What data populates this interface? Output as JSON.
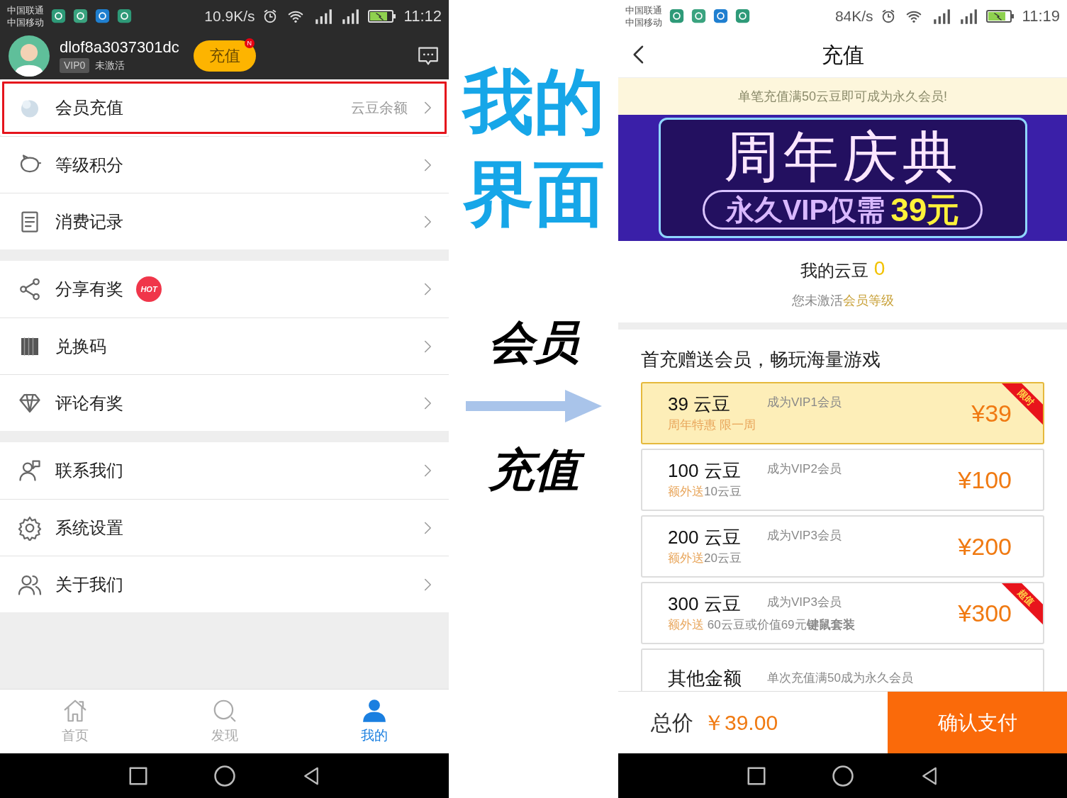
{
  "left_phone": {
    "status_bar": {
      "carriers": [
        "中国联通",
        "中国移动"
      ],
      "speed": "10.9K/s",
      "time": "11:12"
    },
    "profile": {
      "username": "dlof8a3037301dc",
      "vip": "VIP0",
      "state": "未激活",
      "recharge_button": "充值",
      "badge": "N"
    },
    "menu_groups": [
      {
        "items": [
          {
            "label": "会员充值",
            "hint": "云豆余额",
            "highlighted": true
          },
          {
            "label": "等级积分",
            "highlighted": false
          },
          {
            "label": "消费记录",
            "highlighted": false
          }
        ]
      },
      {
        "items": [
          {
            "label": "分享有奖",
            "badge": "HOT",
            "highlighted": false
          },
          {
            "label": "兑换码",
            "highlighted": false
          },
          {
            "label": "评论有奖",
            "highlighted": false
          }
        ]
      },
      {
        "items": [
          {
            "label": "联系我们",
            "highlighted": false
          },
          {
            "label": "系统设置",
            "highlighted": false
          },
          {
            "label": "关于我们",
            "highlighted": false
          }
        ]
      }
    ],
    "tabs": [
      {
        "label": "首页",
        "selected": false
      },
      {
        "label": "发现",
        "selected": false
      },
      {
        "label": "我的",
        "selected": true
      }
    ]
  },
  "annotation": {
    "title_lines": [
      "我的",
      "界面"
    ],
    "from": "会员",
    "to": "充值"
  },
  "right_phone": {
    "status_bar": {
      "carriers": [
        "中国联通",
        "中国移动"
      ],
      "speed": "84K/s",
      "time": "11:19"
    },
    "title": "充值",
    "notice": "单笔充值满50云豆即可成为永久会员!",
    "banner": {
      "title": "周年庆典",
      "subtitle": "永久VIP仅需",
      "price": "39元"
    },
    "balance": {
      "label": "我的云豆",
      "value": "0"
    },
    "level_hint": {
      "text": "您未激活",
      "link": "会员等级"
    },
    "section_title": "首充赠送会员，畅玩海量游戏",
    "packages": [
      {
        "kind": "offer",
        "amount": "39 云豆",
        "benefit": "成为VIP1会员",
        "extra_label": "周年特惠 限一周",
        "price": "¥39",
        "tag": "限时",
        "selected": true
      },
      {
        "kind": "offer",
        "amount": "100 云豆",
        "benefit": "成为VIP2会员",
        "extra_label": "额外送",
        "extra_text": "10云豆",
        "price": "¥100",
        "selected": false
      },
      {
        "kind": "offer",
        "amount": "200 云豆",
        "benefit": "成为VIP3会员",
        "extra_label": "额外送",
        "extra_text": "20云豆",
        "price": "¥200",
        "selected": false
      },
      {
        "kind": "offer",
        "amount": "300 云豆",
        "benefit": "成为VIP3会员",
        "extra_label": "额外送",
        "extra_text": " 60云豆或价值69元**键鼠套装**",
        "price": "¥300",
        "tag": "超值",
        "selected": false
      },
      {
        "kind": "custom",
        "amount": "其他金额",
        "benefit": "单次充值满50成为永久会员",
        "selected": false
      }
    ],
    "total": {
      "label": "总价",
      "value": "￥39.00"
    },
    "pay_button": "确认支付"
  }
}
